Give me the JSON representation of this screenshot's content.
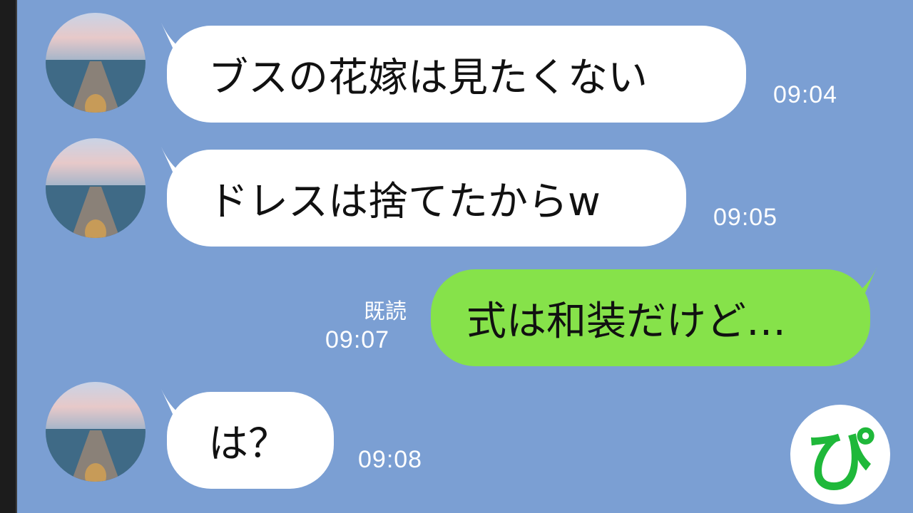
{
  "messages": [
    {
      "text": "ブスの花嫁は見たくない",
      "time": "09:04"
    },
    {
      "text": "ドレスは捨てたからw",
      "time": "09:05"
    },
    {
      "text": "式は和装だけど…",
      "time": "09:07",
      "read": "既読"
    },
    {
      "text": "は？",
      "time": "09:08"
    }
  ],
  "logo": {
    "text": "ぴ"
  },
  "colors": {
    "background": "#7b9fd3",
    "sent_bubble": "#86e24a",
    "received_bubble": "#ffffff"
  }
}
